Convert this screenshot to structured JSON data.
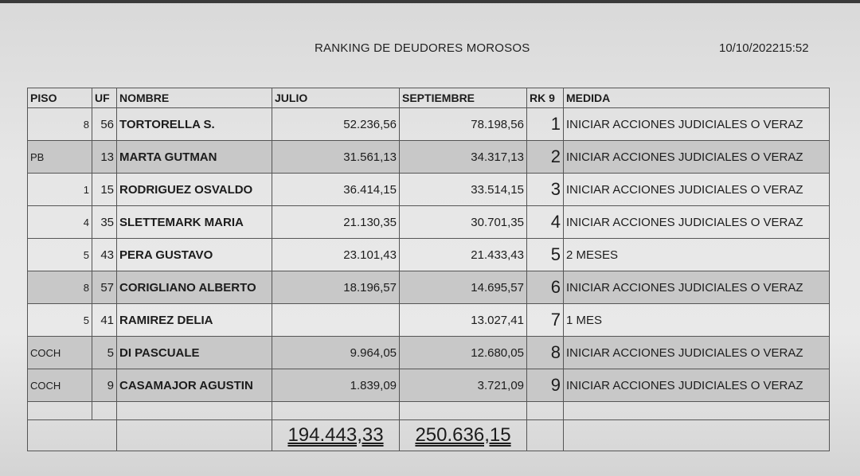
{
  "report": {
    "title": "RANKING DE DEUDORES MOROSOS",
    "timestamp": "10/10/202215:52"
  },
  "table": {
    "headers": {
      "piso": "PISO",
      "uf": "UF",
      "nombre": "NOMBRE",
      "julio": "JULIO",
      "septiembre": "SEPTIEMBRE",
      "rk": "RK 9",
      "medida": "MEDIDA"
    },
    "rows": [
      {
        "piso": "8",
        "uf": "56",
        "nombre": "TORTORELLA S.",
        "julio": "52.236,56",
        "septiembre": "78.198,56",
        "rk": "1",
        "medida": "INICIAR ACCIONES JUDICIALES O VERAZ"
      },
      {
        "piso": "PB",
        "uf": "13",
        "nombre": "MARTA GUTMAN",
        "julio": "31.561,13",
        "septiembre": "34.317,13",
        "rk": "2",
        "medida": "INICIAR ACCIONES JUDICIALES O VERAZ"
      },
      {
        "piso": "1",
        "uf": "15",
        "nombre": "RODRIGUEZ OSVALDO",
        "julio": "36.414,15",
        "septiembre": "33.514,15",
        "rk": "3",
        "medida": "INICIAR ACCIONES JUDICIALES O VERAZ"
      },
      {
        "piso": "4",
        "uf": "35",
        "nombre": "SLETTEMARK MARIA",
        "julio": "21.130,35",
        "septiembre": "30.701,35",
        "rk": "4",
        "medida": "INICIAR ACCIONES JUDICIALES O VERAZ"
      },
      {
        "piso": "5",
        "uf": "43",
        "nombre": "PERA GUSTAVO",
        "julio": "23.101,43",
        "septiembre": "21.433,43",
        "rk": "5",
        "medida": "2 MESES"
      },
      {
        "piso": "8",
        "uf": "57",
        "nombre": "CORIGLIANO ALBERTO",
        "julio": "18.196,57",
        "septiembre": "14.695,57",
        "rk": "6",
        "medida": "INICIAR ACCIONES JUDICIALES O VERAZ"
      },
      {
        "piso": "5",
        "uf": "41",
        "nombre": "RAMIREZ DELIA",
        "julio": "",
        "septiembre": "13.027,41",
        "rk": "7",
        "medida": "1 MES"
      },
      {
        "piso": "COCH",
        "uf": "5",
        "nombre": "DI PASCUALE",
        "julio": "9.964,05",
        "septiembre": "12.680,05",
        "rk": "8",
        "medida": "INICIAR ACCIONES JUDICIALES O VERAZ"
      },
      {
        "piso": "COCH",
        "uf": "9",
        "nombre": "CASAMAJOR AGUSTIN",
        "julio": "1.839,09",
        "septiembre": "3.721,09",
        "rk": "9",
        "medida": "INICIAR ACCIONES JUDICIALES O VERAZ"
      }
    ],
    "totals": {
      "julio": "194.443,33",
      "septiembre": "250.636,15"
    }
  }
}
